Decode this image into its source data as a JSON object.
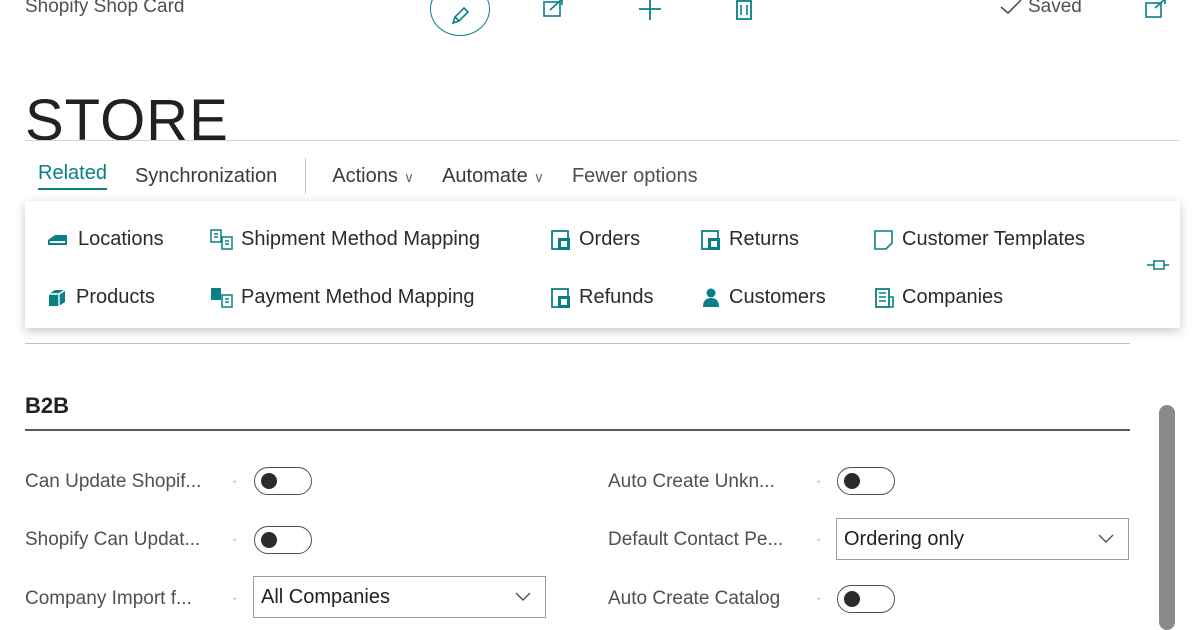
{
  "header": {
    "caption": "Shopify Shop Card",
    "saved_label": "Saved",
    "title": "STORE"
  },
  "tabs": [
    {
      "label": "Related",
      "active": true
    },
    {
      "label": "Synchronization"
    },
    {
      "label": "Actions"
    },
    {
      "label": "Automate"
    },
    {
      "label": "Fewer options"
    }
  ],
  "menu": {
    "locations": "Locations",
    "shipment_method_mapping": "Shipment Method Mapping",
    "orders": "Orders",
    "returns": "Returns",
    "customer_templates": "Customer Templates",
    "products": "Products",
    "payment_method_mapping": "Payment Method Mapping",
    "refunds": "Refunds",
    "customers": "Customers",
    "companies": "Companies"
  },
  "section": {
    "title": "B2B",
    "fields": {
      "can_update_shopify": {
        "label": "Can Update Shopif...",
        "value": false
      },
      "shopify_can_update": {
        "label": "Shopify Can Updat...",
        "value": false
      },
      "company_import": {
        "label": "Company Import f...",
        "value": "All Companies"
      },
      "auto_create_unknown": {
        "label": "Auto Create Unkn...",
        "value": false
      },
      "default_contact": {
        "label": "Default Contact Pe...",
        "value": "Ordering only"
      },
      "auto_create_catalog": {
        "label": "Auto Create Catalog",
        "value": false
      }
    }
  },
  "colors": {
    "accent": "#0a7f86",
    "text": "#212121",
    "muted": "#505050"
  }
}
